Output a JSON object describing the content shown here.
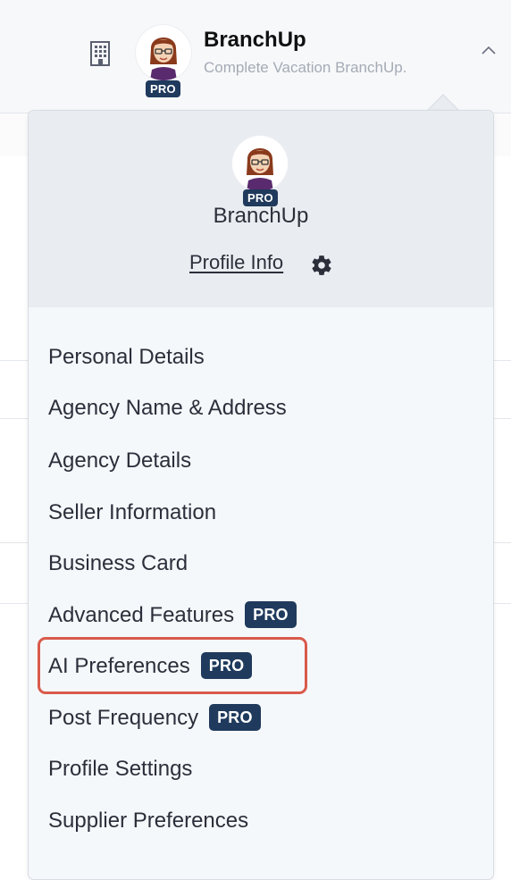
{
  "header": {
    "brand_name": "BranchUp",
    "subtitle": "Complete Vacation BranchUp.",
    "pro_badge": "PRO"
  },
  "dropdown": {
    "name": "BranchUp",
    "pro_badge": "PRO",
    "profile_info_label": "Profile Info",
    "menu": [
      {
        "label": "Personal Details",
        "pro": ""
      },
      {
        "label": "Agency Name & Address",
        "pro": ""
      },
      {
        "label": "Agency Details",
        "pro": ""
      },
      {
        "label": "Seller Information",
        "pro": ""
      },
      {
        "label": "Business Card",
        "pro": ""
      },
      {
        "label": "Advanced Features",
        "pro": "PRO"
      },
      {
        "label": "AI Preferences",
        "pro": "PRO"
      },
      {
        "label": "Post Frequency",
        "pro": "PRO"
      },
      {
        "label": "Profile Settings",
        "pro": ""
      },
      {
        "label": "Supplier Preferences",
        "pro": ""
      }
    ]
  },
  "icons": {
    "building": "building-icon",
    "chevron": "chevron-up-icon",
    "gear": "gear-icon"
  },
  "colors": {
    "pro_badge": "#1f3a5c",
    "highlight": "#d95a4b",
    "dropdown_header": "#e9edf1"
  }
}
